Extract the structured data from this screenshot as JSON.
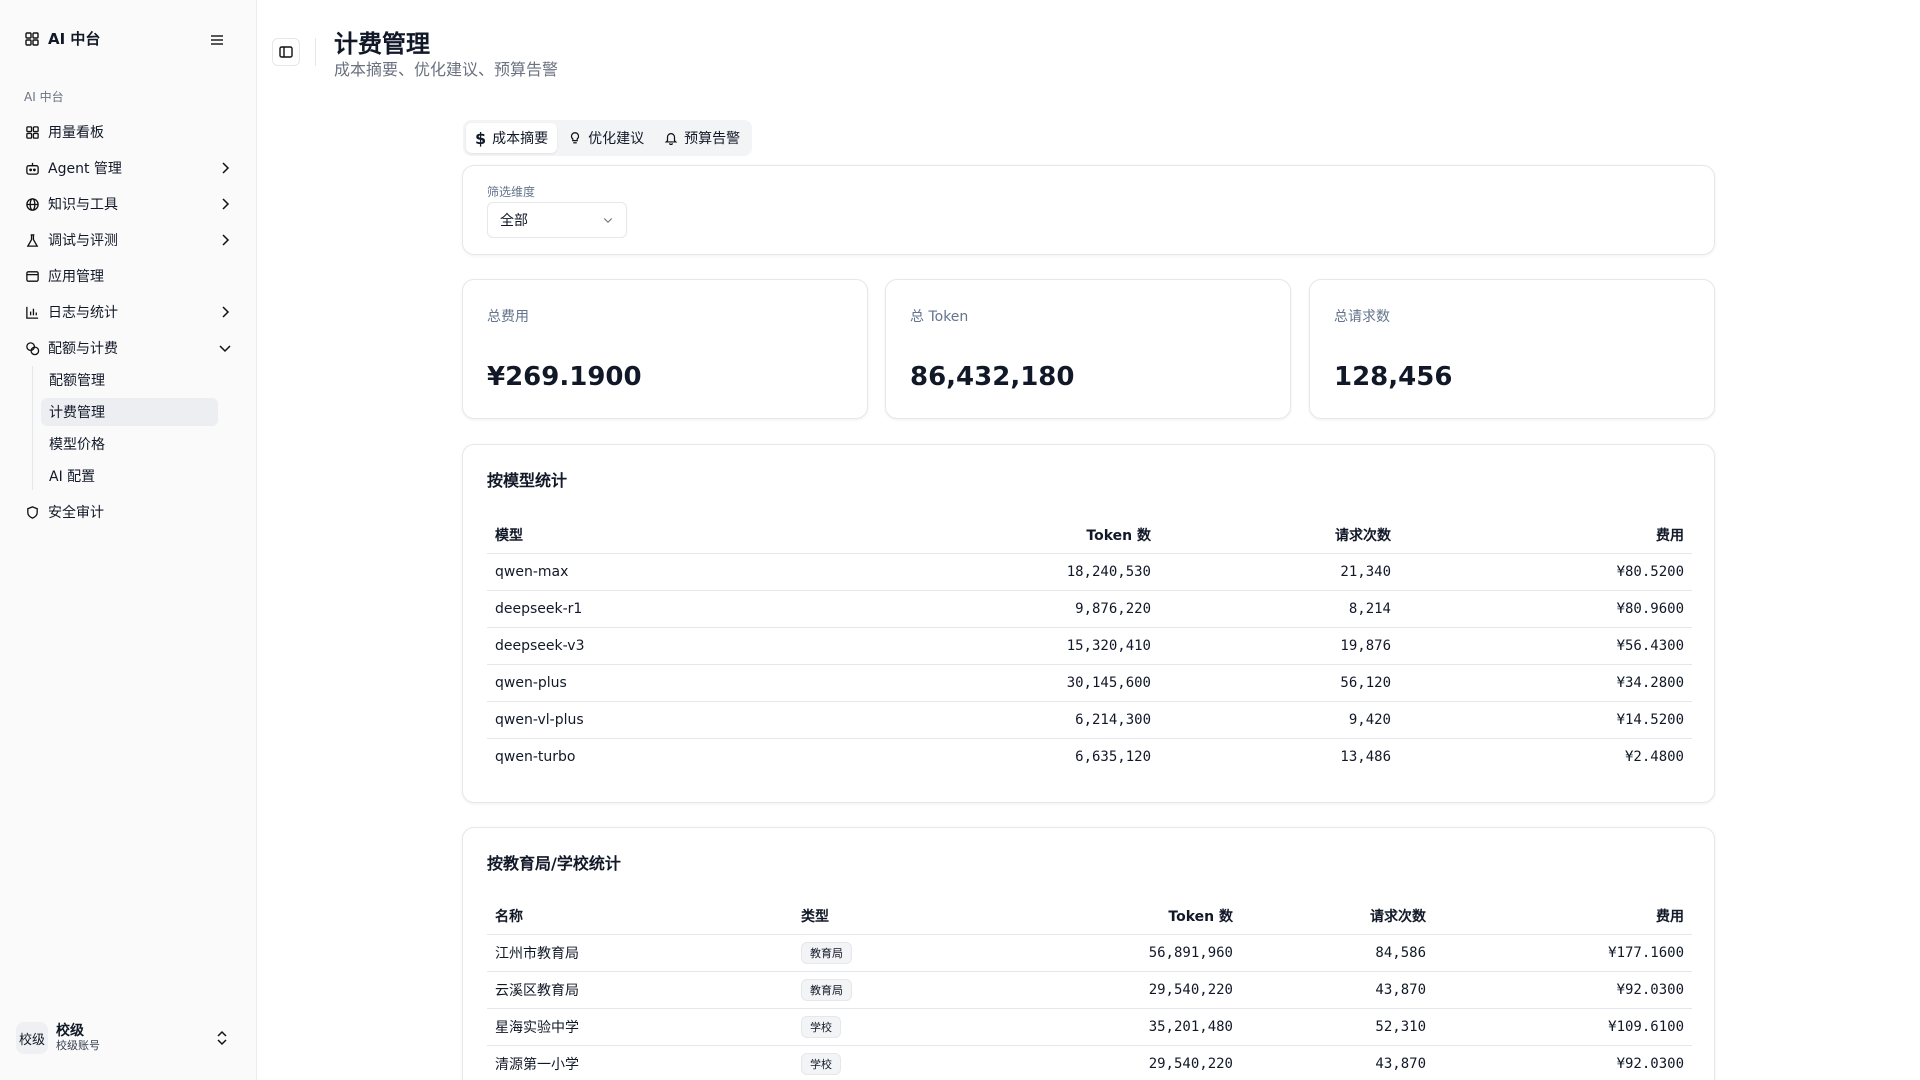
{
  "sidebar": {
    "brand": "AI 中台",
    "section_label": "AI 中台",
    "items": [
      {
        "label": "用量看板"
      },
      {
        "label": "Agent 管理"
      },
      {
        "label": "知识与工具"
      },
      {
        "label": "调试与评测"
      },
      {
        "label": "应用管理"
      },
      {
        "label": "日志与统计"
      },
      {
        "label": "配额与计费"
      },
      {
        "label": "安全审计"
      }
    ],
    "sub_items": [
      {
        "label": "配额管理"
      },
      {
        "label": "计费管理"
      },
      {
        "label": "模型价格"
      },
      {
        "label": "AI 配置"
      }
    ],
    "user": {
      "avatar": "校级",
      "name": "校级",
      "role": "校级账号"
    }
  },
  "header": {
    "title": "计费管理",
    "subtitle": "成本摘要、优化建议、预算告警"
  },
  "tabs": [
    {
      "label": "成本摘要",
      "icon": "dollar-icon"
    },
    {
      "label": "优化建议",
      "icon": "lightbulb-icon"
    },
    {
      "label": "预算告警",
      "icon": "bell-icon"
    }
  ],
  "filter": {
    "label": "筛选维度",
    "value": "全部"
  },
  "stats": [
    {
      "label": "总费用",
      "value": "¥269.1900"
    },
    {
      "label": "总 Token",
      "value": "86,432,180"
    },
    {
      "label": "总请求数",
      "value": "128,456"
    }
  ],
  "model_table": {
    "title": "按模型统计",
    "headers": [
      "模型",
      "Token 数",
      "请求次数",
      "费用"
    ],
    "rows": [
      [
        "qwen-max",
        "18,240,530",
        "21,340",
        "¥80.5200"
      ],
      [
        "deepseek-r1",
        "9,876,220",
        "8,214",
        "¥80.9600"
      ],
      [
        "deepseek-v3",
        "15,320,410",
        "19,876",
        "¥56.4300"
      ],
      [
        "qwen-plus",
        "30,145,600",
        "56,120",
        "¥34.2800"
      ],
      [
        "qwen-vl-plus",
        "6,214,300",
        "9,420",
        "¥14.5200"
      ],
      [
        "qwen-turbo",
        "6,635,120",
        "13,486",
        "¥2.4800"
      ]
    ]
  },
  "org_table": {
    "title": "按教育局/学校统计",
    "headers": [
      "名称",
      "类型",
      "Token 数",
      "请求次数",
      "费用"
    ],
    "rows": [
      [
        "江州市教育局",
        "教育局",
        "56,891,960",
        "84,586",
        "¥177.1600"
      ],
      [
        "云溪区教育局",
        "教育局",
        "29,540,220",
        "43,870",
        "¥92.0300"
      ],
      [
        "星海实验中学",
        "学校",
        "35,201,480",
        "52,310",
        "¥109.6100"
      ],
      [
        "清源第一小学",
        "学校",
        "29,540,220",
        "43,870",
        "¥92.0300"
      ]
    ]
  }
}
